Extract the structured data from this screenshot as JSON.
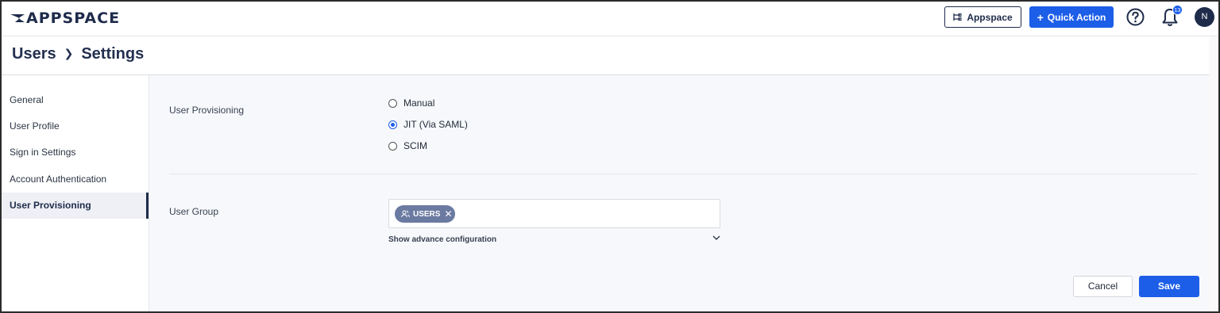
{
  "topbar": {
    "logo_text": "APPSPACE",
    "appspace_label": "Appspace",
    "quick_action_label": "Quick Action",
    "notification_count": "13",
    "avatar_initial": "N"
  },
  "breadcrumb": {
    "items": [
      "Users",
      "Settings"
    ]
  },
  "sidebar": {
    "items": [
      {
        "label": "General"
      },
      {
        "label": "User Profile"
      },
      {
        "label": "Sign in Settings"
      },
      {
        "label": "Account Authentication"
      },
      {
        "label": "User Provisioning"
      }
    ],
    "active": "User Provisioning"
  },
  "provisioning": {
    "label": "User Provisioning",
    "options": [
      {
        "label": "Manual",
        "checked": false
      },
      {
        "label": "JIT (Via SAML)",
        "checked": true
      },
      {
        "label": "SCIM",
        "checked": false
      }
    ]
  },
  "user_group": {
    "label": "User Group",
    "chips": [
      "USERS"
    ],
    "advanced_link": "Show advance configuration"
  },
  "actions": {
    "cancel_label": "Cancel",
    "save_label": "Save"
  },
  "colors": {
    "brand_navy": "#1e2b4a",
    "primary_blue": "#1d5ee8",
    "chip_bg": "#6b7aa1"
  }
}
